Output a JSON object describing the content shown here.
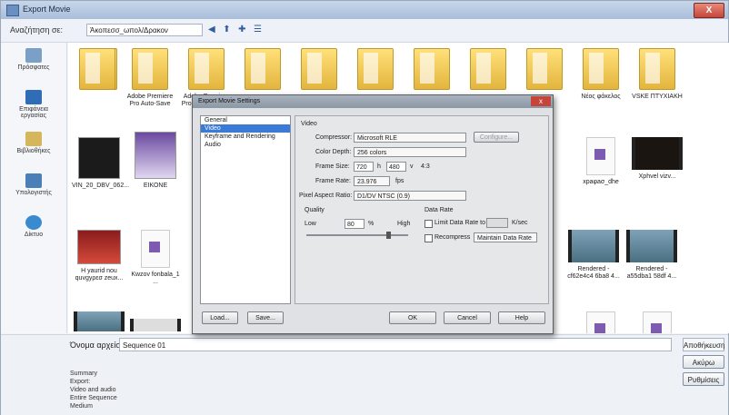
{
  "window": {
    "title": "Export Movie",
    "close_label": "X"
  },
  "address": {
    "label": "Αναζήτηση σε:",
    "location": "Άκοπεσσ_ωπολ/Δρακον"
  },
  "sidebar": {
    "items": [
      {
        "label": "Πρόσφατες",
        "icon": "recent-icon"
      },
      {
        "label": "Επιφάνεια εργασίας",
        "icon": "desktop-icon"
      },
      {
        "label": "Βιβλιοθήκες",
        "icon": "libraries-icon"
      },
      {
        "label": "Υπολογιστής",
        "icon": "computer-icon"
      },
      {
        "label": "Δίκτυο",
        "icon": "network-icon"
      }
    ]
  },
  "files": {
    "row1": [
      {
        "label": ""
      },
      {
        "label": "Adobe Premiere Pro Auto-Save"
      },
      {
        "label": "Adobe Premiere Pro Preview Files"
      },
      {
        "label": ""
      },
      {
        "label": ""
      },
      {
        "label": ""
      },
      {
        "label": ""
      },
      {
        "label": ""
      },
      {
        "label": ""
      },
      {
        "label": "Νέος φάκελος"
      },
      {
        "label": "VSKE ΠΤΥΧΙΑΚΗ"
      }
    ],
    "row2": [
      {
        "label": "VIN_20_DBV_062..."
      },
      {
        "label": "ΕΙΚΟΝΕ"
      },
      {
        "label": ""
      },
      {
        "label": "xpaφaσ_dhe"
      },
      {
        "label": "Xphvel vizv..."
      }
    ],
    "row3": [
      {
        "label": "H yaurid nou quvgyρεσ zeux..."
      },
      {
        "label": "Kwzov fonbala_1 ..."
      },
      {
        "label": "Rendered - cf62e4c4 6ba8 4..."
      },
      {
        "label": "Rendered - a55dba1 58df 4..."
      }
    ]
  },
  "filename": {
    "label": "Όνομα αρχείου:",
    "value": "Sequence 01",
    "save_label": "Αποθήκευση"
  },
  "buttons": {
    "save": "Ακύρω",
    "cancel": "Ακύρωση",
    "settings": "Ρυθμίσεις"
  },
  "summary": {
    "lines": [
      "Summary",
      "Export:",
      "Video and audio",
      "Entire Sequence",
      "",
      "Medium"
    ]
  },
  "modal": {
    "title": "Export Movie Settings",
    "close_label": "x",
    "categories": [
      "General",
      "Video",
      "Keyframe and Rendering",
      "Audio"
    ],
    "selected_index": 1,
    "video": {
      "section": "Video",
      "compressor_label": "Compressor:",
      "compressor_value": "Microsoft RLE",
      "configure_label": "Configure...",
      "color_depth_label": "Color Depth:",
      "color_depth_value": "256 colors",
      "frame_size_label": "Frame Size:",
      "width": "720",
      "h_label": "h",
      "height": "480",
      "v_label": "v",
      "aspect": "4:3",
      "frame_rate_label": "Frame Rate:",
      "frame_rate": "23.976",
      "fps": "fps",
      "pixel_aspect_label": "Pixel Aspect Ratio:",
      "pixel_aspect_value": "D1/DV NTSC (0.9)",
      "quality_section": "Quality",
      "low_label": "Low",
      "quality_value": "80",
      "quality_unit": "%",
      "high_label": "High",
      "data_rate_section": "Data Rate",
      "limit_label": "Limit Data Rate to",
      "limit_unit": "K/sec",
      "recompress_label": "Recompress",
      "recompress_value": "Maintain Data Rate"
    },
    "load_label": "Load...",
    "save_label": "Save...",
    "ok_label": "OK",
    "cancel_label": "Cancel",
    "help_label": "Help"
  }
}
